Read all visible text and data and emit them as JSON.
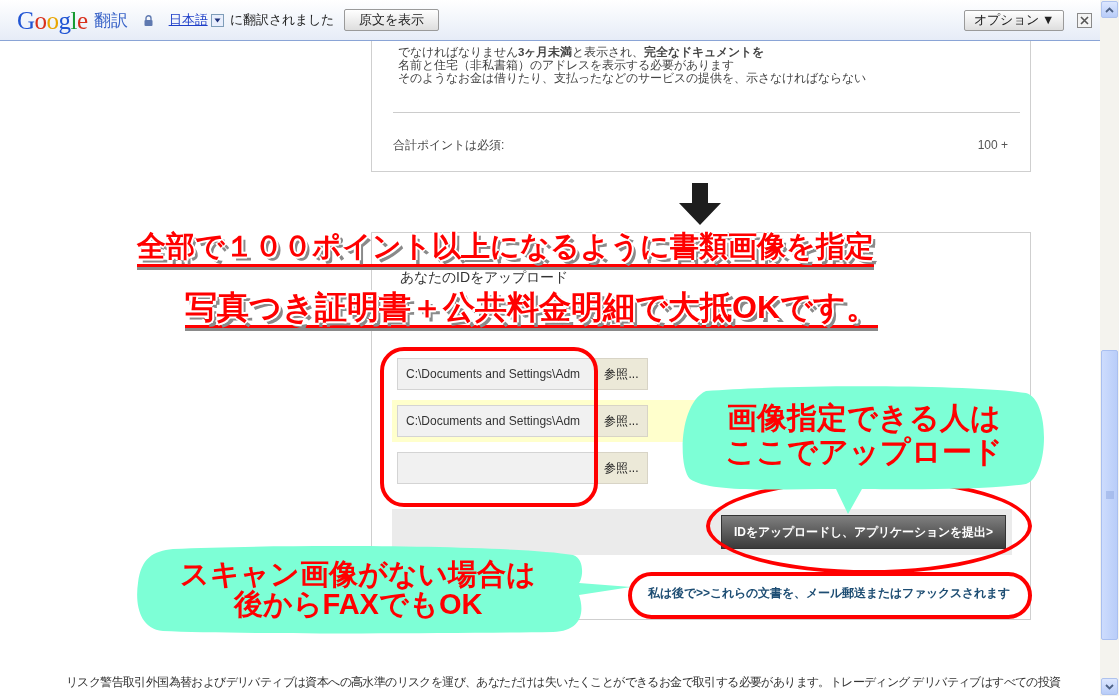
{
  "toolbar": {
    "logo": "Google",
    "service": "翻訳",
    "language": "日本語",
    "status": "に翻訳されました",
    "show_original_button": "原文を表示",
    "options_button": "オプション ▼"
  },
  "requirements_card": {
    "lines": [
      "でなければなりません**3ヶ月未満**と表示され、**完全なドキュメントを**",
      "名前と住宅（非私書箱）のアドレスを表示する必要があります",
      "そのようなお金は借りたり、支払ったなどのサービスの提供を、示さなければならない"
    ],
    "total_label": "合計ポイントは必須:",
    "total_value": "100 +"
  },
  "upload_card": {
    "heading": "あなたのIDをアップロード",
    "files": [
      {
        "value": "C:\\Documents and Settings\\Adm",
        "button": "参照...",
        "highlighted": false
      },
      {
        "value": "C:\\Documents and Settings\\Adm",
        "button": "参照...",
        "highlighted": true
      },
      {
        "button": "参照...",
        "highlighted": false
      }
    ],
    "submit_button": "IDをアップロードし、アプリケーションを提出>",
    "later_link": "私は後で>>これらの文書を、メール郵送またはファックスされます"
  },
  "disclaimer": "リスク警告取引外国為替およびデリバティブは資本への高水準のリスクを運び、あなただけは失いたくことができるお金で取引する必要があります。トレーディング デリバティブはすべての投資",
  "annotations": {
    "banners": [
      "全部で１００ポイント以上になるように書類画像を指定",
      "写真つき証明書＋公共料金明細で大抵OKです。"
    ],
    "callouts": [
      {
        "lines": [
          "画像指定できる人は",
          "ここでアップロード"
        ]
      },
      {
        "lines": [
          "スキャン画像がない場合は",
          "後からFAXでもOK"
        ]
      }
    ]
  }
}
